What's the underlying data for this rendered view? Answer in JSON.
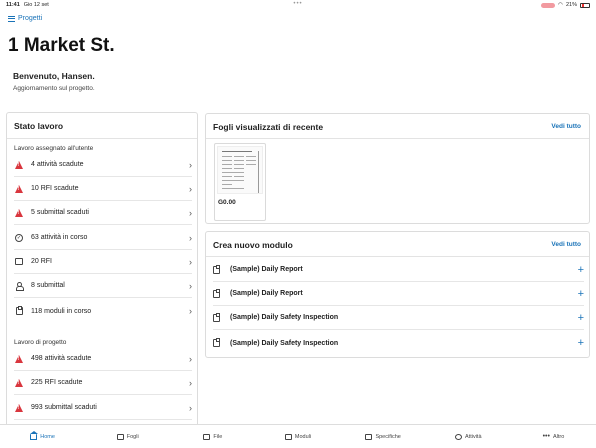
{
  "status_bar": {
    "time": "11:41",
    "date": "Gio 12 set",
    "battery": "21%"
  },
  "nav": {
    "projects_label": "Progetti"
  },
  "project": {
    "title": "1 Market St."
  },
  "welcome": {
    "title": "Benvenuto, Hansen.",
    "subtitle": "Aggiornamento sul progetto."
  },
  "status_card": {
    "title": "Stato lavoro",
    "assigned_label": "Lavoro assegnato all'utente",
    "assigned": [
      {
        "label": "4 attività scadute",
        "icon": "warning-icon"
      },
      {
        "label": "10 RFI scadute",
        "icon": "warning-icon"
      },
      {
        "label": "5 submittal scaduti",
        "icon": "warning-icon"
      },
      {
        "label": "63 attività in corso",
        "icon": "check-circle-icon"
      },
      {
        "label": "20 RFI",
        "icon": "chat-icon"
      },
      {
        "label": "8 submittal",
        "icon": "person-icon"
      },
      {
        "label": "118 moduli in corso",
        "icon": "clipboard-icon"
      }
    ],
    "project_label": "Lavoro di progetto",
    "project": [
      {
        "label": "498 attività scadute",
        "icon": "warning-icon"
      },
      {
        "label": "225 RFI scadute",
        "icon": "warning-icon"
      },
      {
        "label": "993 submittal scaduti",
        "icon": "warning-icon"
      }
    ]
  },
  "recent_card": {
    "title": "Fogli visualizzati di recente",
    "see_all": "Vedi tutto",
    "sheets": [
      {
        "name": "G0.00"
      }
    ]
  },
  "module_card": {
    "title": "Crea nuovo modulo",
    "see_all": "Vedi tutto",
    "items": [
      {
        "label": "(Sample) Daily Report"
      },
      {
        "label": "(Sample) Daily Report"
      },
      {
        "label": "(Sample) Daily Safety Inspection"
      },
      {
        "label": "(Sample) Daily Safety Inspection"
      }
    ]
  },
  "tabbar": {
    "items": [
      {
        "label": "Home",
        "icon": "home-icon",
        "active": true
      },
      {
        "label": "Fogli",
        "icon": "sheets-icon"
      },
      {
        "label": "File",
        "icon": "file-icon"
      },
      {
        "label": "Moduli",
        "icon": "forms-icon"
      },
      {
        "label": "Specifiche",
        "icon": "specs-icon"
      },
      {
        "label": "Attività",
        "icon": "tasks-icon"
      },
      {
        "label": "Altro",
        "icon": "more-icon"
      }
    ]
  },
  "colors": {
    "accent": "#1a73b8",
    "warning": "#d9363e"
  }
}
